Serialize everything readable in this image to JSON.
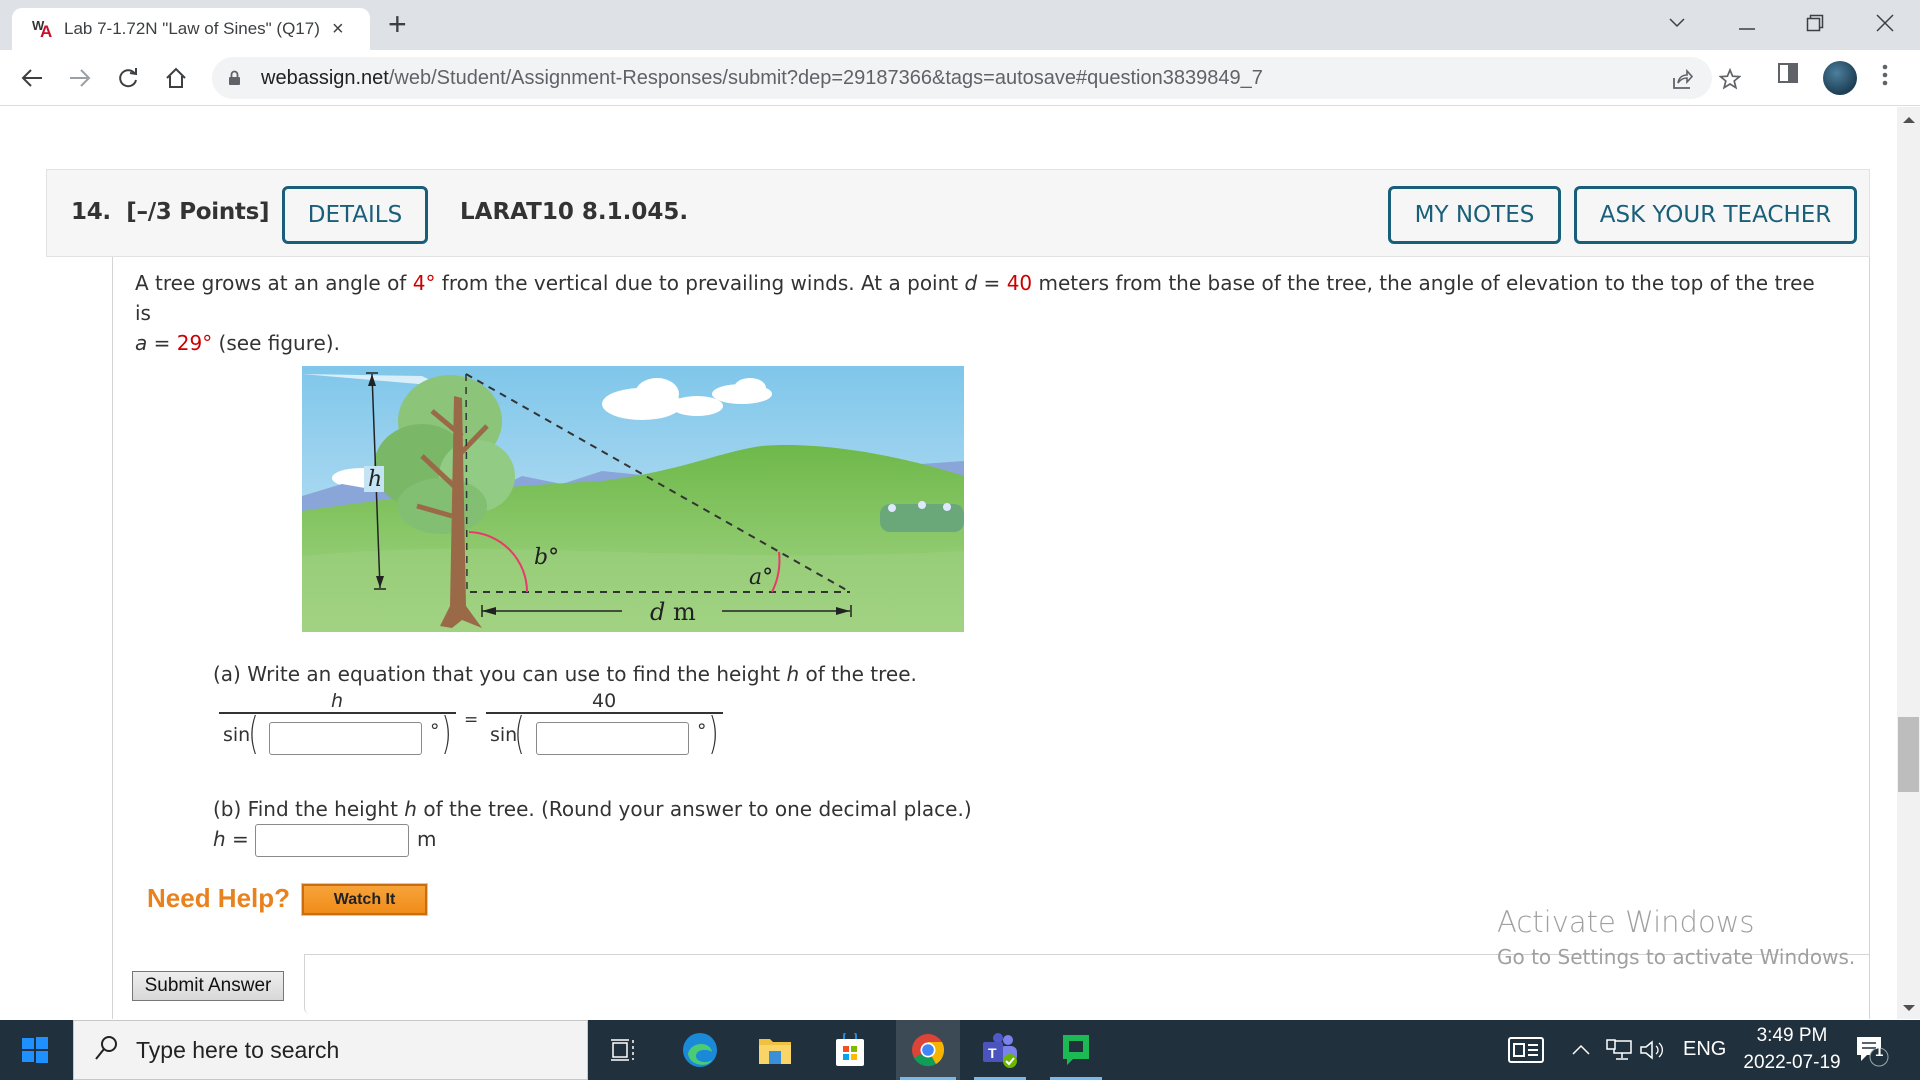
{
  "browser": {
    "tab": {
      "title": "Lab 7-1.72N \"Law of Sines\" (Q17)",
      "favicon": "webassign-icon",
      "close": "×"
    },
    "new_tab": "+",
    "url_host": "webassign.net",
    "url_path": "/web/Student/Assignment-Responses/submit?dep=29187366&tags=autosave#question3839849_7",
    "window_controls": {
      "dropdown": "⌄",
      "minimize": "—",
      "restore": "❐",
      "close": "✕"
    }
  },
  "question": {
    "number": "14.",
    "points": "[–/3 Points]",
    "details_label": "DETAILS",
    "code": "LARAT10 8.1.045.",
    "my_notes_label": "MY NOTES",
    "ask_teacher_label": "ASK YOUR TEACHER",
    "prompt": {
      "p1": "A tree grows at an angle of ",
      "angle": "4°",
      "p2": " from the vertical due to prevailing winds. At a point ",
      "d_var": "d",
      "p3": " = ",
      "d_val": "40",
      "p4": " meters from the base of the tree, the angle of elevation to the top of the tree is",
      "a_var": "a",
      "p5": " = ",
      "a_val": "29°",
      "p6": " (see figure)."
    },
    "figure": {
      "label_h": "h",
      "label_b": "b°",
      "label_a": "a°",
      "label_d": "d",
      "label_m": "m"
    },
    "part_a": {
      "text_1": "(a) Write an equation that you can use to find the height ",
      "var": "h",
      "text_2": " of the tree.",
      "left_numerator": "h",
      "right_numerator": "40",
      "sin_label": "sin",
      "degree": "°",
      "equals": "=",
      "left_input_value": "",
      "right_input_value": ""
    },
    "part_b": {
      "text_1": "(b) Find the height ",
      "var": "h",
      "text_2": " of the tree. (Round your answer to one decimal place.)",
      "lhs_var": "h",
      "lhs_eq": " =",
      "input_value": "",
      "unit": "m"
    },
    "need_help": "Need Help?",
    "watch_it": "Watch It",
    "submit": "Submit Answer"
  },
  "watermark": {
    "line1": "Activate Windows",
    "line2": "Go to Settings to activate Windows."
  },
  "taskbar": {
    "search_placeholder": "Type here to search",
    "language": "ENG",
    "time": "3:49 PM",
    "date": "2022-07-19",
    "notification_count": "1"
  },
  "colors": {
    "accent": "#1a5f7a",
    "given_value": "#cc0000",
    "help_orange": "#e8821e"
  }
}
